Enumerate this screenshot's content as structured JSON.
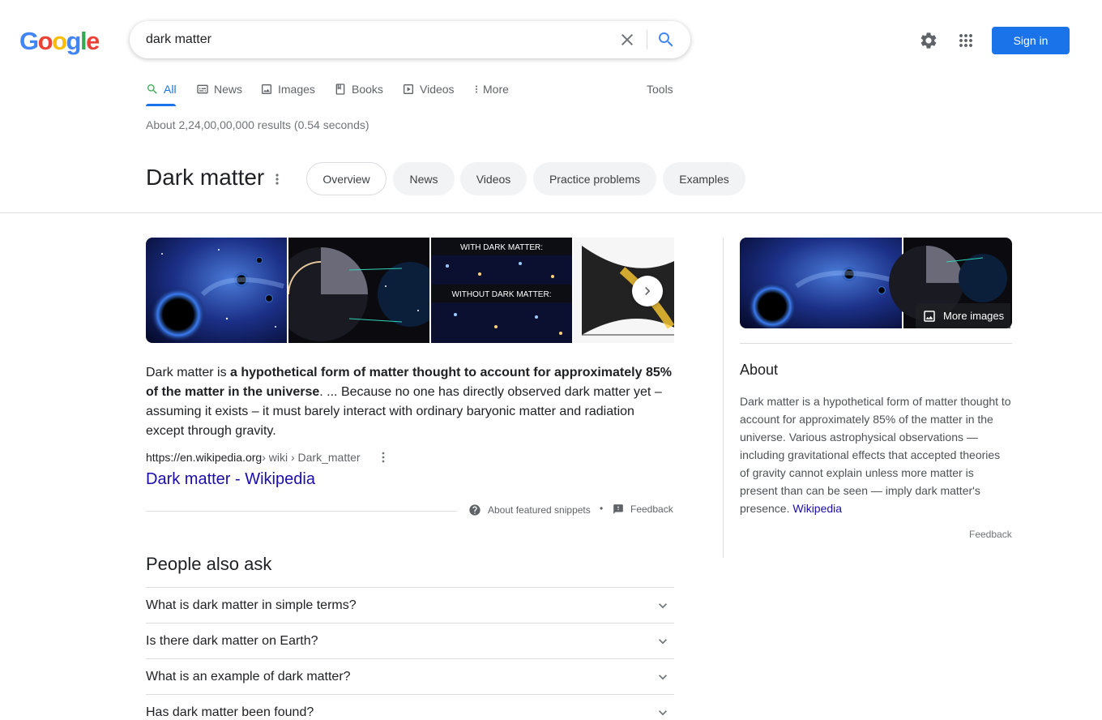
{
  "logo": {
    "letters": [
      "G",
      "o",
      "o",
      "g",
      "l",
      "e"
    ],
    "colors": [
      "#4285F4",
      "#EA4335",
      "#FBBC05",
      "#4285F4",
      "#34A853",
      "#EA4335"
    ]
  },
  "search": {
    "query": "dark matter",
    "clear_icon": "close-icon",
    "search_icon": "search-icon"
  },
  "header": {
    "settings_icon": "gear-icon",
    "apps_icon": "apps-grid-icon",
    "sign_in": "Sign in"
  },
  "tabs": [
    {
      "label": "All",
      "icon": "search-icon",
      "active": true
    },
    {
      "label": "News",
      "icon": "news-icon"
    },
    {
      "label": "Images",
      "icon": "image-icon"
    },
    {
      "label": "Books",
      "icon": "book-icon"
    },
    {
      "label": "Videos",
      "icon": "play-icon"
    },
    {
      "label": "More",
      "icon": "more-vert-icon"
    }
  ],
  "tools": "Tools",
  "result_stats": "About 2,24,00,00,000 results (0.54 seconds)",
  "entity": {
    "title": "Dark matter",
    "chips": [
      "Overview",
      "News",
      "Videos",
      "Practice problems",
      "Examples"
    ]
  },
  "images": {
    "thumb_texts": {
      "with": "WITH DARK MATTER:",
      "without": "WITHOUT DARK MATTER:"
    }
  },
  "snippet": {
    "prefix": "Dark matter is ",
    "bold": "a hypothetical form of matter thought to account for approximately 85% of the matter in the universe",
    "suffix": ". ... Because no one has directly observed dark matter yet – assuming it exists – it must barely interact with ordinary baryonic matter and radiation except through gravity.",
    "cite_domain": "https://en.wikipedia.org",
    "cite_path": " › wiki › Dark_matter",
    "link_title": "Dark matter - Wikipedia",
    "about_snippets": "About featured snippets",
    "separator": "•",
    "feedback": "Feedback"
  },
  "paa": {
    "title": "People also ask",
    "questions": [
      "What is dark matter in simple terms?",
      "Is there dark matter on Earth?",
      "What is an example of dark matter?",
      "Has dark matter been found?"
    ]
  },
  "knowledge_panel": {
    "more_images": "More images",
    "about_title": "About",
    "description": "Dark matter is a hypothetical form of matter thought to account for approximately 85% of the matter in the universe. Various astrophysical observations — including gravitational effects that accepted theories of gravity cannot explain unless more matter is present than can be seen — imply dark matter's presence. ",
    "source_link": "Wikipedia",
    "feedback": "Feedback"
  }
}
